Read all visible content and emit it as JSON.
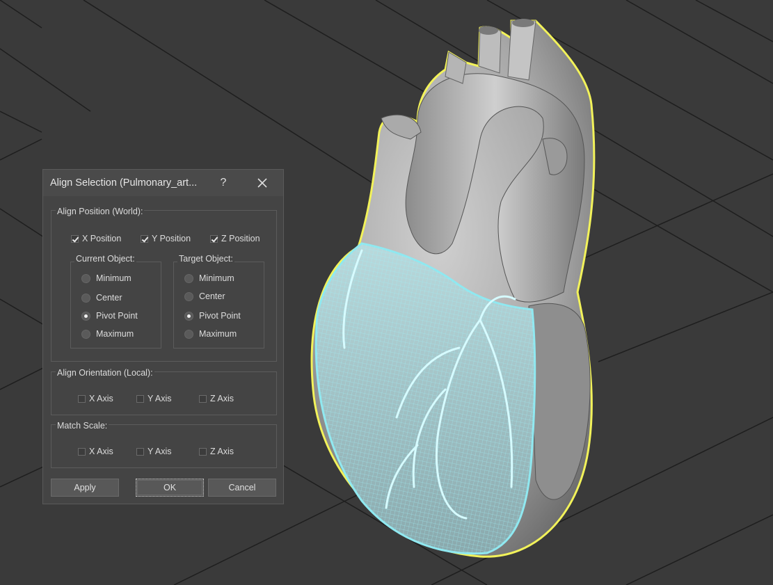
{
  "dialog": {
    "title": "Align Selection (Pulmonary_art...",
    "help_label": "?",
    "align_position": {
      "label": "Align Position (World):",
      "checks": [
        {
          "label": "X Position",
          "checked": true
        },
        {
          "label": "Y Position",
          "checked": true
        },
        {
          "label": "Z Position",
          "checked": true
        }
      ],
      "current_object": {
        "label": "Current Object:",
        "options": [
          "Minimum",
          "Center",
          "Pivot Point",
          "Maximum"
        ],
        "selected": "Pivot Point"
      },
      "target_object": {
        "label": "Target Object:",
        "options": [
          "Minimum",
          "Center",
          "Pivot Point",
          "Maximum"
        ],
        "selected": "Pivot Point"
      }
    },
    "align_orientation": {
      "label": "Align Orientation (Local):",
      "checks": [
        {
          "label": "X Axis",
          "checked": false
        },
        {
          "label": "Y Axis",
          "checked": false
        },
        {
          "label": "Z Axis",
          "checked": false
        }
      ]
    },
    "match_scale": {
      "label": "Match Scale:",
      "checks": [
        {
          "label": "X Axis",
          "checked": false
        },
        {
          "label": "Y Axis",
          "checked": false
        },
        {
          "label": "Z Axis",
          "checked": false
        }
      ]
    },
    "buttons": {
      "apply": "Apply",
      "ok": "OK",
      "cancel": "Cancel"
    }
  },
  "colors": {
    "viewport_bg": "#3a3a3a",
    "selection_outline": "#f2f25a",
    "wireframe": "#8fe8f0",
    "dialog_bg": "#444444"
  }
}
